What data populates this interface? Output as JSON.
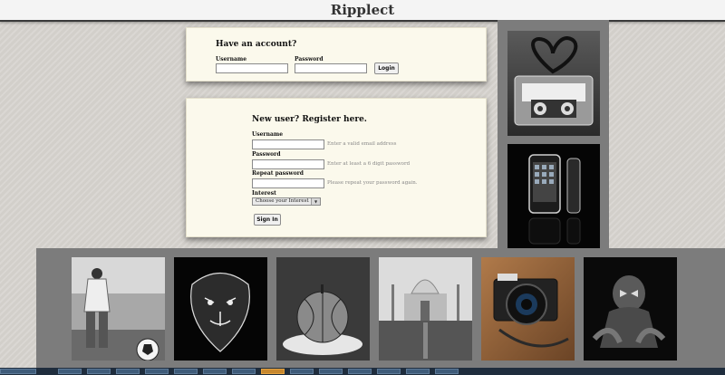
{
  "app": {
    "title": "Ripplect"
  },
  "login": {
    "heading": "Have an account?",
    "username_label": "Username",
    "password_label": "Password",
    "username_value": "",
    "password_value": "",
    "button_label": "Login"
  },
  "register": {
    "heading": "New user? Register here.",
    "username_label": "Username",
    "username_hint": "Enter a valid email address",
    "password_label": "Password",
    "password_hint": "Enter at least a 6 digit password",
    "repeat_label": "Repeat password",
    "repeat_hint": "Please repeat your password again.",
    "interest_label": "Interest",
    "interest_selected": "Choose your Interest",
    "button_label": "Sign In"
  },
  "gallery": {
    "right_images": [
      "cassette-heart-photo",
      "iphone-photo"
    ],
    "bottom_images": [
      "soccer-player-photo",
      "tiger-photo",
      "dessert-photo",
      "taj-mahal-photo",
      "camera-photo",
      "spiderman-photo"
    ]
  }
}
